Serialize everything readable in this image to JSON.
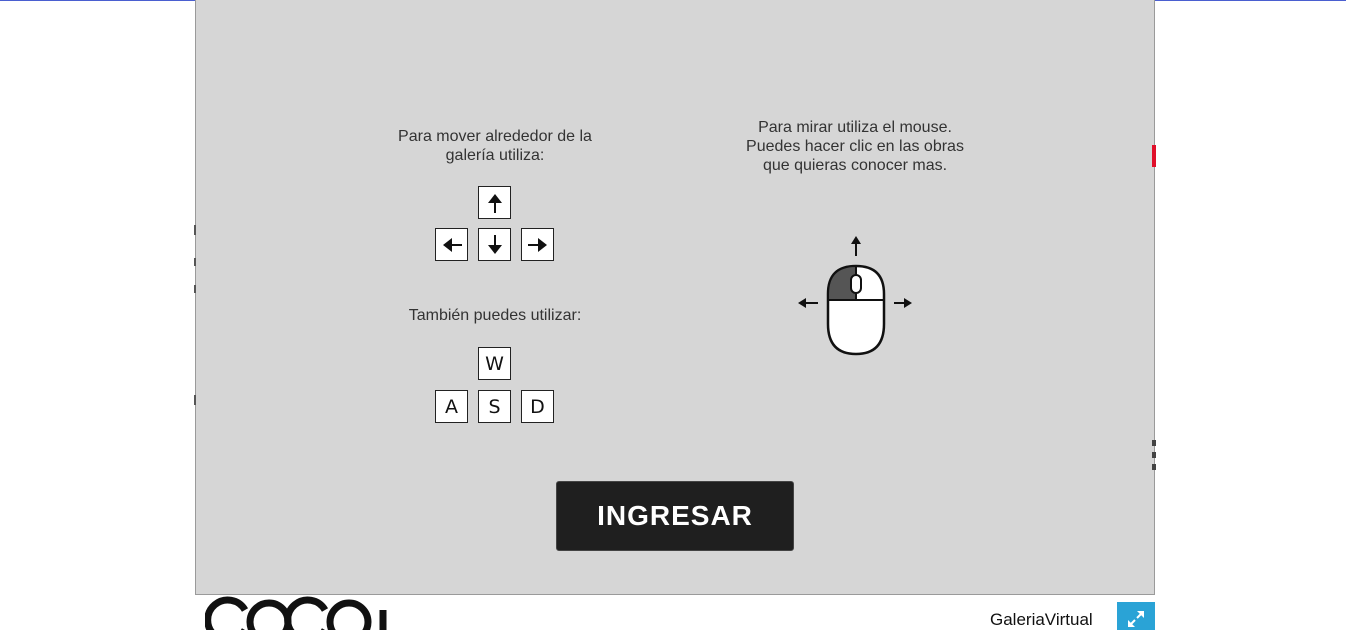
{
  "instructions": {
    "move_line1": "Para mover alrededor de la",
    "move_line2": "galería  utiliza:",
    "alt_label": "También  puedes utilizar:",
    "look_line1": "Para mirar utiliza el mouse.",
    "look_line2": "Puedes hacer clic en las obras",
    "look_line3": "que quieras conocer mas."
  },
  "keys": {
    "arrows": [
      "arrow-up-icon",
      "arrow-left-icon",
      "arrow-down-icon",
      "arrow-right-icon"
    ],
    "w": "W",
    "a": "A",
    "s": "S",
    "d": "D"
  },
  "enter_button": {
    "label": "INGRESAR"
  },
  "footer": {
    "logo_icon": "cocoa-logo-icon",
    "gallery_label": "GaleriaVirtual",
    "fullscreen_icon": "expand-icon"
  },
  "colors": {
    "overlay_bg": "#d6d6d6",
    "button_bg": "#1f1f1f",
    "fullscreen_bg": "#2aa3d6",
    "top_line": "#4a5fd0"
  }
}
